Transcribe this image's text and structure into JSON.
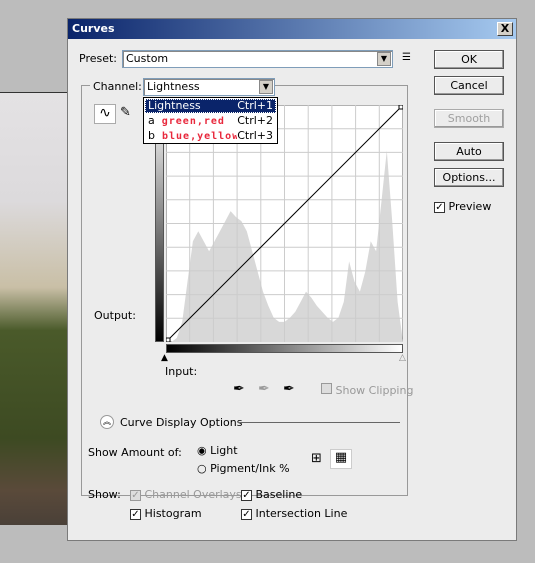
{
  "dialog": {
    "title": "Curves",
    "close": "X"
  },
  "preset": {
    "label": "Preset:",
    "value": "Custom"
  },
  "channel": {
    "label": "Channel:",
    "value": "Lightness",
    "options": [
      {
        "prefix": "",
        "name": "Lightness",
        "shortcut": "Ctrl+1"
      },
      {
        "prefix": "a",
        "name": "green,red",
        "shortcut": "Ctrl+2"
      },
      {
        "prefix": "b",
        "name": "blue,yellow",
        "shortcut": "Ctrl+3"
      }
    ]
  },
  "graph": {
    "output_label": "Output:",
    "input_label": "Input:",
    "show_clipping": "Show Clipping",
    "show_clipping_checked": false
  },
  "buttons": {
    "ok": "OK",
    "cancel": "Cancel",
    "smooth": "Smooth",
    "auto": "Auto",
    "options": "Options..."
  },
  "preview": {
    "label": "Preview",
    "checked": true
  },
  "display_options": {
    "title": "Curve Display Options",
    "show_amount_label": "Show Amount of:",
    "light": "Light",
    "pigment": "Pigment/Ink %",
    "selected": "Light",
    "show_label": "Show:",
    "channel_overlays": "Channel Overlays",
    "baseline": "Baseline",
    "histogram": "Histogram",
    "intersection_line": "Intersection Line",
    "checked": {
      "channel_overlays": true,
      "baseline": true,
      "histogram": true,
      "intersection_line": true
    }
  },
  "colors": {
    "title_start": "#0a246a",
    "menu_highlight": "#0a246a",
    "channel_name_red": "#e8283c"
  }
}
